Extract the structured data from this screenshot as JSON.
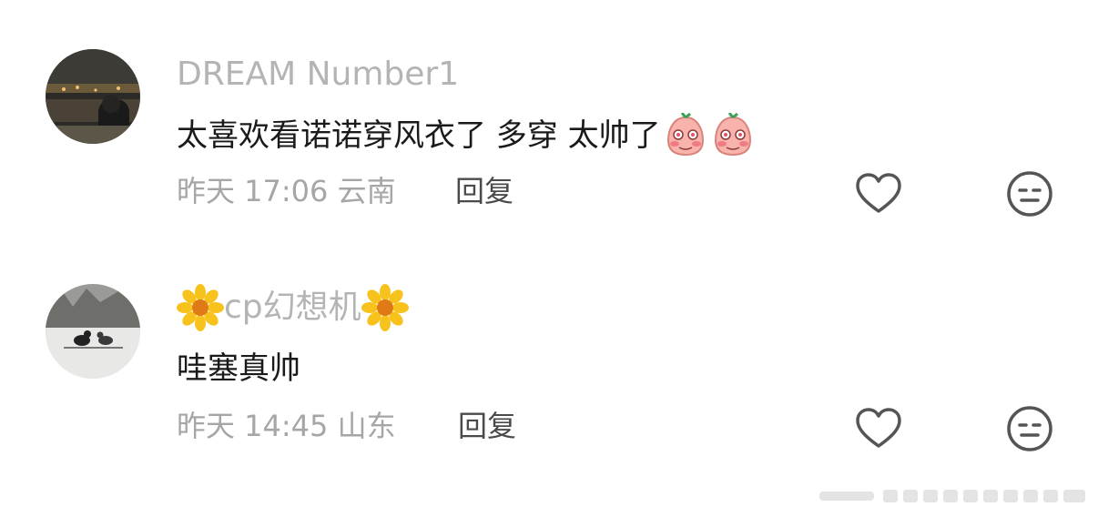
{
  "comments": [
    {
      "username": "DREAM Number1",
      "content": "太喜欢看诺诺穿风衣了 多穿 太帅了",
      "stickers": [
        "blushing-pink-sticker",
        "blushing-pink-sticker"
      ],
      "meta": "昨天 17:06 云南",
      "reply_label": "回复",
      "avatar": "night-river-avatar",
      "colors": {
        "sticker": "#f5a9a3"
      }
    },
    {
      "username": "cp幻想机",
      "username_decor": [
        "sunflower-icon",
        "sunflower-icon"
      ],
      "content": "哇塞真帅",
      "meta": "昨天 14:45 山东",
      "reply_label": "回复",
      "avatar": "cats-snow-avatar",
      "colors": {
        "flower_petal": "#f7c21b",
        "flower_center": "#e07a16"
      }
    }
  ],
  "colors": {
    "username": "#b4b4b4",
    "content": "#1a1a1a",
    "meta": "#a6a6a6",
    "reply": "#4a4a4a",
    "icon": "#555555"
  }
}
